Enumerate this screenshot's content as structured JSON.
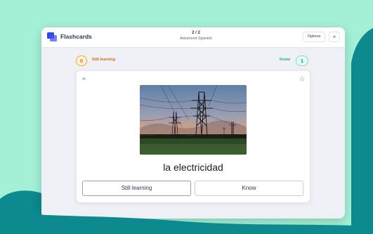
{
  "app": {
    "title": "Flashcards",
    "progress": "2 / 2",
    "deck_name": "Advanced Spanish",
    "options_label": "Options",
    "close_label": "×"
  },
  "score": {
    "still_learning_count": "0",
    "still_learning_label": "Still learning",
    "know_label": "Know",
    "know_count": "1"
  },
  "card": {
    "term": "la electricidad",
    "image_subject": "power transmission towers at sunset"
  },
  "buttons": {
    "still_learning": "Still learning",
    "know": "Know"
  },
  "colors": {
    "background_mint": "#a3f0d6",
    "wave_teal": "#0c8a8f",
    "learning_orange": "#f5a623",
    "know_green": "#18ae79",
    "brand_blue": "#4255ff"
  },
  "icons": {
    "audio": "speaker-icon",
    "favorite": "star-icon",
    "app": "cards-logo-icon",
    "close": "close-icon"
  }
}
